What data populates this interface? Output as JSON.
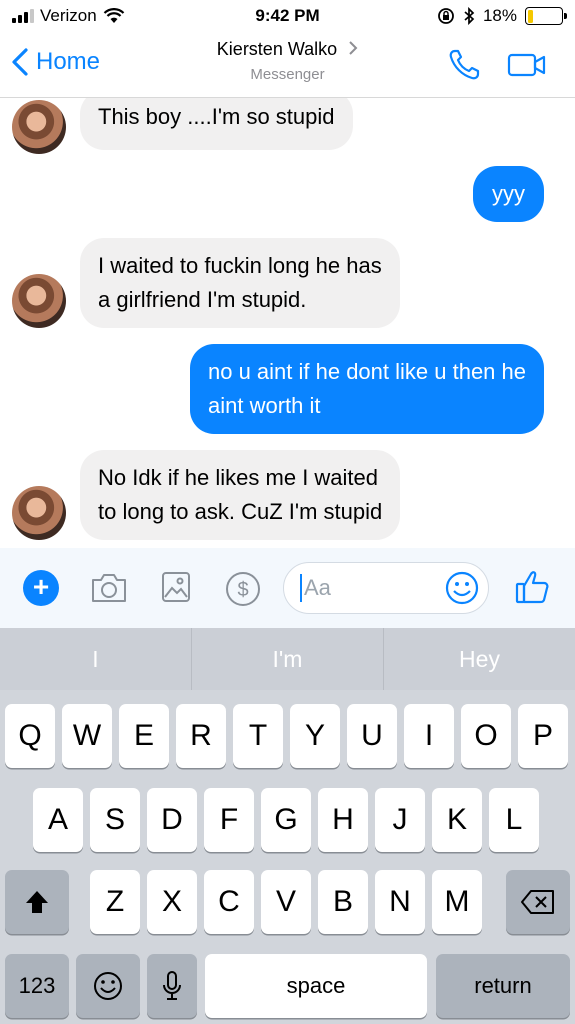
{
  "status_bar": {
    "carrier": "Verizon",
    "time": "9:42 PM",
    "battery_percent_label": "18%",
    "battery_level": 0.18,
    "battery_color": "#f5c800"
  },
  "nav": {
    "back_label": "Home",
    "contact_name": "Kiersten Walko",
    "subtitle": "Messenger",
    "icons": [
      "chevron-left-icon",
      "chevron-right-icon",
      "phone-icon",
      "video-camera-icon"
    ]
  },
  "messages": [
    {
      "direction": "in",
      "lines": [
        "This boy ....I'm so stupid"
      ]
    },
    {
      "direction": "out",
      "lines": [
        "yyy"
      ]
    },
    {
      "direction": "in",
      "lines": [
        "I waited to fuckin long he has",
        "a girlfriend I'm stupid."
      ]
    },
    {
      "direction": "out",
      "lines": [
        "no u aint if he dont like u then he",
        "aint worth it"
      ]
    },
    {
      "direction": "in",
      "lines": [
        "No Idk if he likes me I waited",
        "to long to ask. CuZ I'm stupid"
      ]
    }
  ],
  "composer": {
    "placeholder": "Aa",
    "icons": [
      "plus-icon",
      "camera-icon",
      "image-icon",
      "dollar-icon",
      "emoji-icon",
      "thumbs-up-icon"
    ]
  },
  "keyboard": {
    "predictions": [
      "I",
      "I'm",
      "Hey"
    ],
    "row1": [
      "Q",
      "W",
      "E",
      "R",
      "T",
      "Y",
      "U",
      "I",
      "O",
      "P"
    ],
    "row2": [
      "A",
      "S",
      "D",
      "F",
      "G",
      "H",
      "J",
      "K",
      "L"
    ],
    "row3": [
      "Z",
      "X",
      "C",
      "V",
      "B",
      "N",
      "M"
    ],
    "numbers_key": "123",
    "space_key": "space",
    "return_key": "return"
  },
  "colors": {
    "accent": "#0a84ff",
    "incoming_bubble": "#f1f0f0",
    "keyboard_bg": "#d1d5db"
  }
}
